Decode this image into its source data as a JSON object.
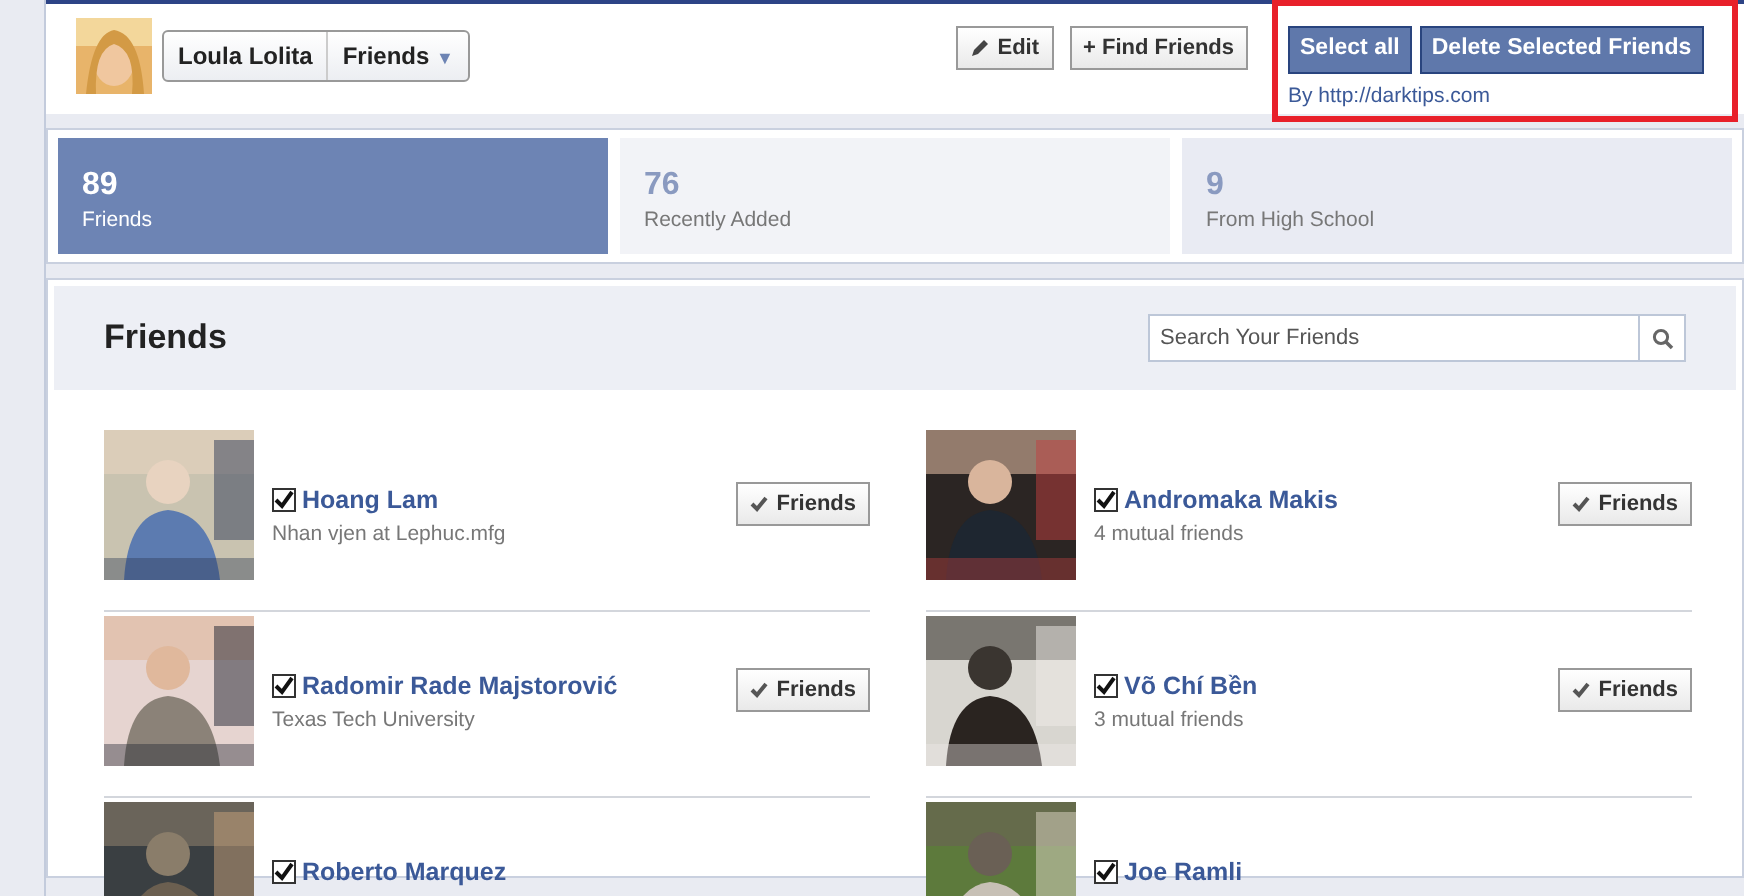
{
  "header": {
    "profile_name": "Loula Lolita",
    "audience": "Friends",
    "audience_caret": "▼",
    "buttons": [
      {
        "kind": "edit",
        "label": "Edit"
      },
      {
        "kind": "find",
        "label": "+ Find Friends"
      }
    ],
    "actions": [
      "Select all",
      "Delete Selected Friends"
    ],
    "credit": "By http://darktips.com"
  },
  "stats": [
    {
      "count": "89",
      "label": "Friends",
      "selected": true
    },
    {
      "count": "76",
      "label": "Recently Added",
      "selected": false
    },
    {
      "count": "9",
      "label": "From High School",
      "selected": false
    }
  ],
  "panel": {
    "title": "Friends",
    "search": {
      "placeholder": "Search Your Friends"
    }
  },
  "friends": [
    {
      "name": "Hoang Lam",
      "detail": "Nhan vjen at Lephuc.mfg",
      "checked": true,
      "button": "Friends"
    },
    {
      "name": "Andromaka Makis",
      "detail": "4 mutual friends",
      "checked": true,
      "button": "Friends"
    },
    {
      "name": "Radomir Rade Majstorović",
      "detail": "Texas Tech University",
      "checked": true,
      "button": "Friends"
    },
    {
      "name": "Võ Chí Bền",
      "detail": "3 mutual friends",
      "checked": true,
      "button": "Friends"
    },
    {
      "name": "Roberto Marquez",
      "checked": true
    },
    {
      "name": "Joe Ramli",
      "checked": true
    }
  ]
}
